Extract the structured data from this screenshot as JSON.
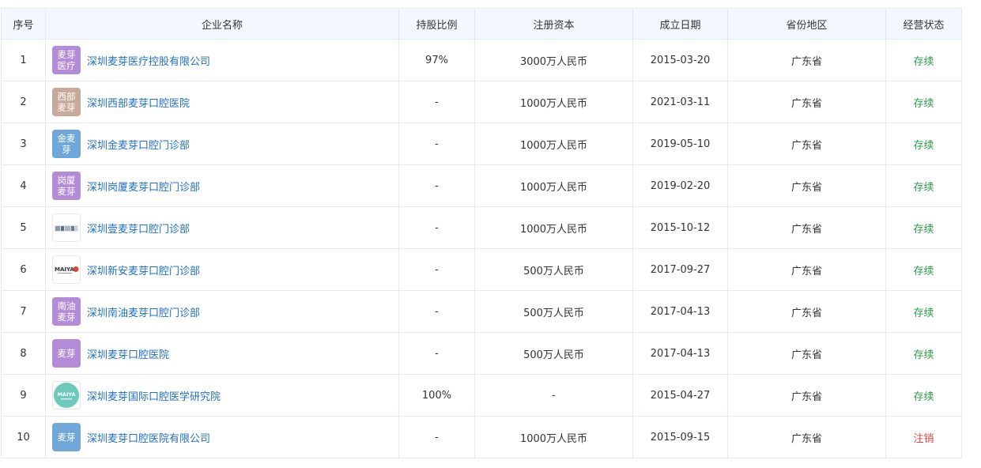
{
  "headers": {
    "index": "序号",
    "name": "企业名称",
    "share": "持股比例",
    "capital": "注册资本",
    "date": "成立日期",
    "region": "省份地区",
    "status": "经营状态"
  },
  "rows": [
    {
      "index": "1",
      "logo_text": "麦芽医疗",
      "logo_color": "#b38bd6",
      "name": "深圳麦芽医疗控股有限公司",
      "share": "97%",
      "capital": "3000万人民币",
      "date": "2015-03-20",
      "region": "广东省",
      "status": "存续"
    },
    {
      "index": "2",
      "logo_text": "西部麦芽",
      "logo_color": "#c9a99a",
      "name": "深圳西部麦芽口腔医院",
      "share": "-",
      "capital": "1000万人民币",
      "date": "2021-03-11",
      "region": "广东省",
      "status": "存续"
    },
    {
      "index": "3",
      "logo_text": "金麦芽",
      "logo_color": "#6fa8d8",
      "name": "深圳金麦芽口腔门诊部",
      "share": "-",
      "capital": "1000万人民币",
      "date": "2019-05-10",
      "region": "广东省",
      "status": "存续"
    },
    {
      "index": "4",
      "logo_text": "岗厦麦芽",
      "logo_color": "#b38bd6",
      "name": "深圳岗厦麦芽口腔门诊部",
      "share": "-",
      "capital": "1000万人民币",
      "date": "2019-02-20",
      "region": "广东省",
      "status": "存续"
    },
    {
      "index": "5",
      "logo_text": "",
      "logo_color": "",
      "name": "深圳壹麦芽口腔门诊部",
      "share": "-",
      "capital": "1000万人民币",
      "date": "2015-10-12",
      "region": "广东省",
      "status": "存续"
    },
    {
      "index": "6",
      "logo_text": "MAIYA",
      "logo_color": "",
      "name": "深圳新安麦芽口腔门诊部",
      "share": "-",
      "capital": "500万人民币",
      "date": "2017-09-27",
      "region": "广东省",
      "status": "存续"
    },
    {
      "index": "7",
      "logo_text": "南油麦芽",
      "logo_color": "#b38bd6",
      "name": "深圳南油麦芽口腔门诊部",
      "share": "-",
      "capital": "500万人民币",
      "date": "2017-04-13",
      "region": "广东省",
      "status": "存续"
    },
    {
      "index": "8",
      "logo_text": "麦芽",
      "logo_color": "#b38bd6",
      "name": "深圳麦芽口腔医院",
      "share": "-",
      "capital": "500万人民币",
      "date": "2017-04-13",
      "region": "广东省",
      "status": "存续"
    },
    {
      "index": "9",
      "logo_text": "MAIYA",
      "logo_color": "#6ec9bd",
      "name": "深圳麦芽国际口腔医学研究院",
      "share": "100%",
      "capital": "-",
      "date": "2015-04-27",
      "region": "广东省",
      "status": "存续"
    },
    {
      "index": "10",
      "logo_text": "麦芽",
      "logo_color": "#6fa8d8",
      "name": "深圳麦芽口腔医院有限公司",
      "share": "-",
      "capital": "1000万人民币",
      "date": "2015-09-15",
      "region": "广东省",
      "status": "注销"
    }
  ]
}
